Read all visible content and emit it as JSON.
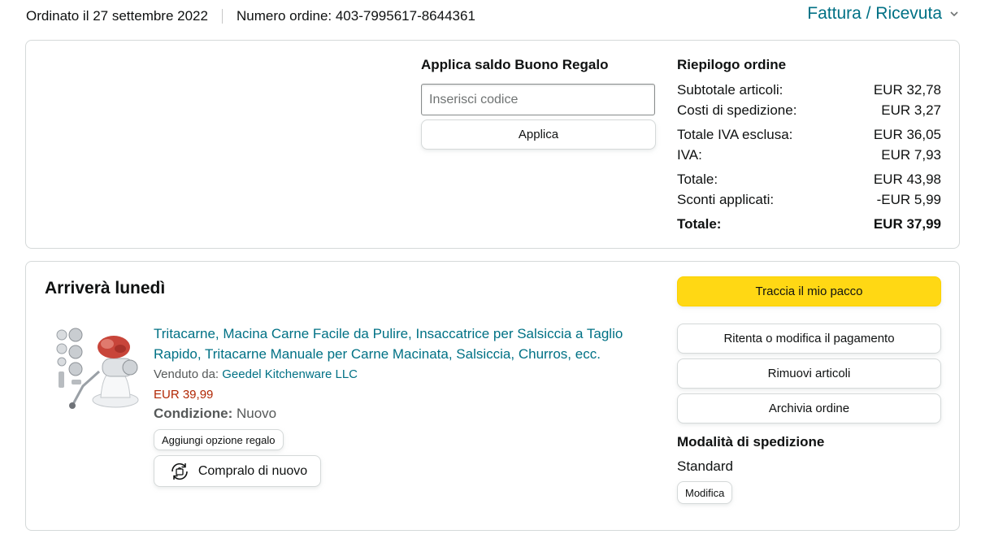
{
  "header": {
    "ordered_on": "Ordinato il 27 settembre 2022",
    "order_number": "Numero ordine: 403-7995617-8644361",
    "invoice_link": "Fattura / Ricevuta",
    "invoice_icon": "chevron-down-icon"
  },
  "gift_card": {
    "title": "Applica saldo Buono Regalo",
    "placeholder": "Inserisci codice",
    "value": "",
    "apply_label": "Applica"
  },
  "summary": {
    "title": "Riepilogo ordine",
    "rows": [
      {
        "label": "Subtotale articoli:",
        "value": "EUR 32,78"
      },
      {
        "label": "Costi di spedizione:",
        "value": "EUR 3,27"
      },
      {
        "label": "Totale IVA esclusa:",
        "value": "EUR 36,05"
      },
      {
        "label": "IVA:",
        "value": "EUR 7,93"
      },
      {
        "label": "Totale:",
        "value": "EUR 43,98"
      },
      {
        "label": "Sconti applicati:",
        "value": "-EUR 5,99"
      },
      {
        "label": "Totale:",
        "value": "EUR 37,99"
      }
    ]
  },
  "shipment": {
    "arrival": "Arriverà lunedì",
    "product": {
      "title": "Tritacarne, Macina Carne Facile da Pulire, Insaccatrice per Salsiccia a Taglio Rapido, Tritacarne Manuale per Carne Macinata, Salsiccia, Churros, ecc.",
      "seller_label": "Venduto da:",
      "seller_name": "Geedel Kitchenware LLC",
      "price": "EUR 39,99",
      "condition_label": "Condizione:",
      "condition_value": "Nuovo",
      "gift_option_label": "Aggiungi opzione regalo",
      "buy_again_label": "Compralo di nuovo",
      "buy_again_icon": "buy-again-icon"
    },
    "actions": {
      "track": "Traccia il mio pacco",
      "retry_payment": "Ritenta o modifica il pagamento",
      "remove_items": "Rimuovi articoli",
      "archive": "Archivia ordine"
    },
    "shipping": {
      "title": "Modalità di spedizione",
      "value": "Standard",
      "modify_label": "Modifica"
    }
  },
  "colors": {
    "link": "#007185",
    "price": "#b12704",
    "primary_button": "#ffd814",
    "border": "#d5d9d9"
  }
}
